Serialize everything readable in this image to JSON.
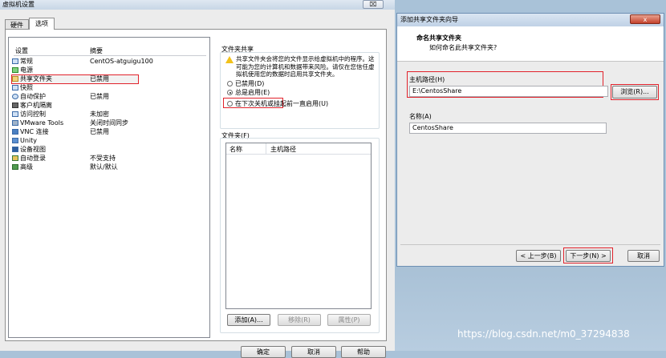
{
  "vm_settings": {
    "title": "虚拟机设置",
    "close_label": "⌧",
    "tabs": [
      "硬件",
      "选项"
    ],
    "list_headers": {
      "setting": "设置",
      "summary": "摘要"
    },
    "rows": [
      {
        "label": "常规",
        "value": "CentOS-atguigu100",
        "icon": "general-icon"
      },
      {
        "label": "电源",
        "value": "",
        "icon": "power-icon"
      },
      {
        "label": "共享文件夹",
        "value": "已禁用",
        "icon": "shared-folder-icon"
      },
      {
        "label": "快照",
        "value": "",
        "icon": "snapshot-icon"
      },
      {
        "label": "自动保护",
        "value": "已禁用",
        "icon": "autoprotect-icon"
      },
      {
        "label": "客户机隔离",
        "value": "",
        "icon": "isolation-icon"
      },
      {
        "label": "访问控制",
        "value": "未加密",
        "icon": "access-control-icon"
      },
      {
        "label": "VMware Tools",
        "value": "关闭时间同步",
        "icon": "vmware-tools-icon"
      },
      {
        "label": "VNC 连接",
        "value": "已禁用",
        "icon": "vnc-icon"
      },
      {
        "label": "Unity",
        "value": "",
        "icon": "unity-icon"
      },
      {
        "label": "设备视图",
        "value": "",
        "icon": "device-view-icon"
      },
      {
        "label": "自动登录",
        "value": "不受支持",
        "icon": "autologin-icon"
      },
      {
        "label": "高级",
        "value": "默认/默认",
        "icon": "advanced-icon"
      }
    ],
    "folder_sharing": {
      "title": "文件夹共享",
      "warning": "共享文件夹会将您的文件显示给虚拟机中的程序。这可能为您的计算机和数据带来风险。请仅在您信任虚拟机使用您的数据时启用共享文件夹。",
      "options": [
        "已禁用(D)",
        "总是启用(E)",
        "在下次关机或挂起前一直启用(U)"
      ],
      "selected": "总是启用(E)"
    },
    "folders": {
      "title": "文件夹(F)",
      "columns": [
        "名称",
        "主机路径"
      ],
      "add": "添加(A)...",
      "remove": "移除(R)",
      "properties": "属性(P)"
    },
    "buttons": {
      "ok": "确定",
      "cancel": "取消",
      "help": "帮助"
    }
  },
  "wizard": {
    "title": "添加共享文件夹向导",
    "close_label": "x",
    "heading": "命名共享文件夹",
    "subheading": "如何命名此共享文件夹?",
    "host_path_label": "主机路径(H)",
    "host_path_value": "E:\\CentosShare",
    "browse": "浏览(R)...",
    "name_label": "名称(A)",
    "name_value": "CentosShare",
    "back": "< 上一步(B)",
    "next": "下一步(N) >",
    "cancel": "取消"
  },
  "watermark": "https://blog.csdn.net/m0_37294838",
  "colors": {
    "highlight_box": "#e1222b",
    "warning": "#f2c21b"
  }
}
